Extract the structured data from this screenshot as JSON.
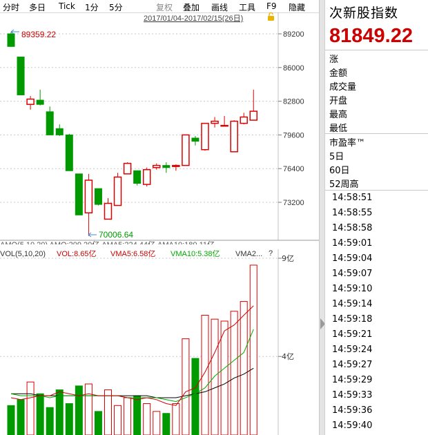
{
  "toolbar": {
    "items": [
      "分时",
      "多日",
      "Tick",
      "1分",
      "5分",
      "复权",
      "叠加",
      "画线",
      "工具",
      "F9",
      "隐藏"
    ]
  },
  "chart": {
    "date_range": "2017/01/04-2017/02/15(26日)",
    "high_label": "89359.22",
    "low_label": "70006.64",
    "price_ticks": [
      "89200",
      "86000",
      "82800",
      "79600",
      "76400",
      "73200"
    ],
    "amo_legend": "AMO(5,10,20)  AMO:209.20亿  AMA5:224.44亿  AMA10:180.11亿",
    "vol_legend": {
      "vol": "VOL(5,10,20)",
      "vol_value": "VOL:8.65亿",
      "vma5": "VMA5:6.58亿",
      "vma10": "VMA10:5.38亿",
      "vma20": "VMA2...",
      "question": "?"
    },
    "vol_ticks": [
      "9亿",
      "4亿"
    ],
    "colors": {
      "up": "#dd0000",
      "down": "#009900",
      "vma5": "#cc0000",
      "vma10": "#00aa00",
      "vma20": "#000000",
      "price_up_text": "#cc0000",
      "price_down_text": "#009900"
    }
  },
  "chart_data": {
    "type": "candlestick",
    "candles": [
      {
        "o": 89200,
        "h": 89359.22,
        "l": 88000,
        "c": 88000
      },
      {
        "o": 87000,
        "h": 87000,
        "l": 83400,
        "c": 83400
      },
      {
        "o": 82500,
        "h": 83300,
        "l": 82000,
        "c": 83000
      },
      {
        "o": 82900,
        "h": 83900,
        "l": 82400,
        "c": 82500
      },
      {
        "o": 81800,
        "h": 82300,
        "l": 79600,
        "c": 79600
      },
      {
        "o": 80200,
        "h": 80600,
        "l": 79500,
        "c": 79600
      },
      {
        "o": 79600,
        "h": 79700,
        "l": 76200,
        "c": 76200
      },
      {
        "o": 75900,
        "h": 75900,
        "l": 72000,
        "c": 72000
      },
      {
        "o": 72200,
        "h": 75900,
        "l": 70006.64,
        "c": 75300
      },
      {
        "o": 74500,
        "h": 74500,
        "l": 72900,
        "c": 73000
      },
      {
        "o": 71600,
        "h": 73600,
        "l": 71600,
        "c": 73100
      },
      {
        "o": 72900,
        "h": 76000,
        "l": 72900,
        "c": 75600
      },
      {
        "o": 75900,
        "h": 77000,
        "l": 75900,
        "c": 76900
      },
      {
        "o": 76200,
        "h": 76200,
        "l": 74800,
        "c": 75000
      },
      {
        "o": 74900,
        "h": 76500,
        "l": 74700,
        "c": 76300
      },
      {
        "o": 76500,
        "h": 76900,
        "l": 76300,
        "c": 76700
      },
      {
        "o": 76700,
        "h": 77000,
        "l": 76000,
        "c": 76500
      },
      {
        "o": 76600,
        "h": 76800,
        "l": 76200,
        "c": 76700
      },
      {
        "o": 76700,
        "h": 79600,
        "l": 76700,
        "c": 79600
      },
      {
        "o": 79300,
        "h": 79500,
        "l": 78600,
        "c": 79000
      },
      {
        "o": 78200,
        "h": 80700,
        "l": 78100,
        "c": 80700
      },
      {
        "o": 80700,
        "h": 81300,
        "l": 80300,
        "c": 80900
      },
      {
        "o": 80500,
        "h": 81400,
        "l": 80500,
        "c": 80500
      },
      {
        "o": 78000,
        "h": 81000,
        "l": 78000,
        "c": 80900
      },
      {
        "o": 80700,
        "h": 81700,
        "l": 80600,
        "c": 81300
      },
      {
        "o": 81000,
        "h": 83900,
        "l": 81000,
        "c": 81849.22
      }
    ],
    "volume_yi": [
      1.5,
      1.8,
      2.7,
      2.1,
      1.4,
      2.3,
      1.6,
      2.5,
      2.6,
      1.2,
      2.3,
      1.5,
      1.9,
      2.0,
      1.6,
      1.2,
      1.1,
      1.6,
      4.9,
      3.9,
      6.1,
      5.9,
      5.8,
      6.3,
      6.8,
      8.65
    ],
    "vma5_yi": [
      1.9,
      1.8,
      1.9,
      2.0,
      2.0,
      2.2,
      2.1,
      2.0,
      2.1,
      2.0,
      2.0,
      2.0,
      1.9,
      1.8,
      1.9,
      1.8,
      1.6,
      1.5,
      2.2,
      2.4,
      3.2,
      4.2,
      5.3,
      5.6,
      6.1,
      6.58
    ],
    "vma10_yi": [
      2.1,
      2.0,
      2.0,
      2.0,
      1.9,
      2.0,
      2.0,
      2.0,
      2.0,
      2.0,
      2.0,
      2.0,
      1.9,
      1.9,
      1.9,
      1.9,
      1.8,
      1.7,
      1.9,
      2.1,
      2.4,
      3.0,
      3.4,
      3.8,
      4.2,
      5.38
    ],
    "vma20_yi": [
      2.1,
      2.1,
      2.1,
      2.0,
      2.0,
      2.0,
      2.0,
      2.0,
      2.0,
      2.0,
      2.0,
      2.0,
      2.0,
      2.0,
      2.0,
      1.9,
      1.9,
      1.9,
      2.0,
      2.1,
      2.2,
      2.4,
      2.6,
      2.9,
      3.1,
      3.4
    ],
    "price_ylim": [
      69000,
      90500
    ],
    "volume_ylim": [
      0,
      9.5
    ]
  },
  "panel": {
    "index_name": "次新股指数",
    "price": "81849.22",
    "fields_a": [
      "涨",
      "金额",
      "成交量",
      "开盘",
      "最高",
      "最低"
    ],
    "fields_b": [
      "市盈率™",
      "5日",
      "60日",
      "52周高"
    ],
    "ticks": [
      "14:58:51",
      "14:58:55",
      "14:58:58",
      "14:59:01",
      "14:59:04",
      "14:59:07",
      "14:59:10",
      "14:59:14",
      "14:59:18",
      "14:59:21",
      "14:59:24",
      "14:59:27",
      "14:59:29",
      "14:59:33",
      "14:59:36",
      "14:59:40"
    ]
  }
}
